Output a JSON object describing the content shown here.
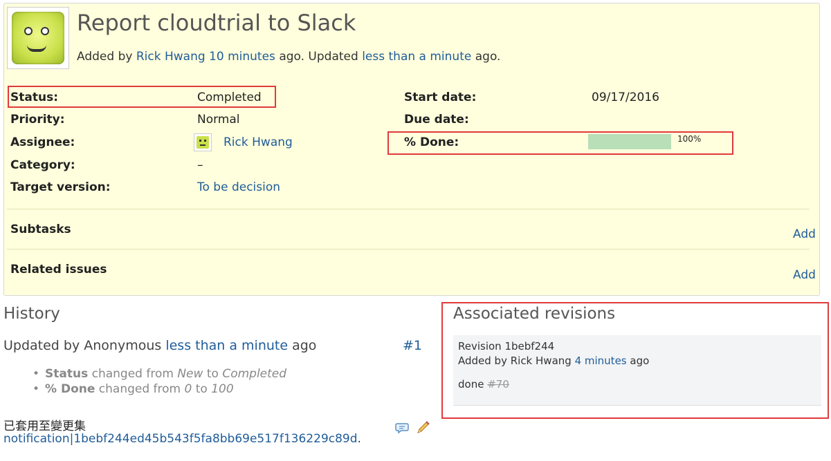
{
  "issue": {
    "title": "Report cloudtrial to Slack",
    "added_by_prefix": "Added by",
    "author": "Rick Hwang",
    "added_ago": "10 minutes",
    "updated_mid": "ago. Updated",
    "updated_ago": "less than a minute",
    "ago": "ago."
  },
  "attributes": {
    "status_label": "Status:",
    "status_value": "Completed",
    "priority_label": "Priority:",
    "priority_value": "Normal",
    "assignee_label": "Assignee:",
    "assignee_value": "Rick Hwang",
    "category_label": "Category:",
    "category_value": "–",
    "target_label": "Target version:",
    "target_value": "To be decision",
    "start_label": "Start date:",
    "start_value": "09/17/2016",
    "due_label": "Due date:",
    "due_value": "",
    "done_label": "% Done:",
    "done_value": "100%",
    "done_ratio": 1.0
  },
  "subtasks": {
    "title": "Subtasks",
    "add": "Add"
  },
  "related": {
    "title": "Related issues",
    "add": "Add"
  },
  "history": {
    "title": "History",
    "entry": {
      "prefix": "Updated by Anonymous",
      "time": "less than a minute",
      "suffix": "ago",
      "number": "#1",
      "changes": [
        {
          "field": "Status",
          "mid": "changed from",
          "from": "New",
          "to_word": "to",
          "to": "Completed"
        },
        {
          "field": "% Done",
          "mid": "changed from",
          "from": "0",
          "to_word": "to",
          "to": "100"
        }
      ],
      "note_zh": "已套用至變更集",
      "note_link": "notification|1bebf244ed45b543f5fa8bb69e517f136229c89d",
      "note_end": "."
    }
  },
  "revisions": {
    "title": "Associated revisions",
    "items": [
      {
        "label": "Revision 1bebf244",
        "added_prefix": "Added by Rick Hwang",
        "time": "4 minutes",
        "suffix": "ago",
        "message": "done",
        "ref": "#70"
      }
    ]
  },
  "colors": {
    "link": "#1f5c99",
    "issue_bg": "#ffffdd",
    "progress": "#b8dfb8",
    "highlight": "#e03a3a"
  }
}
